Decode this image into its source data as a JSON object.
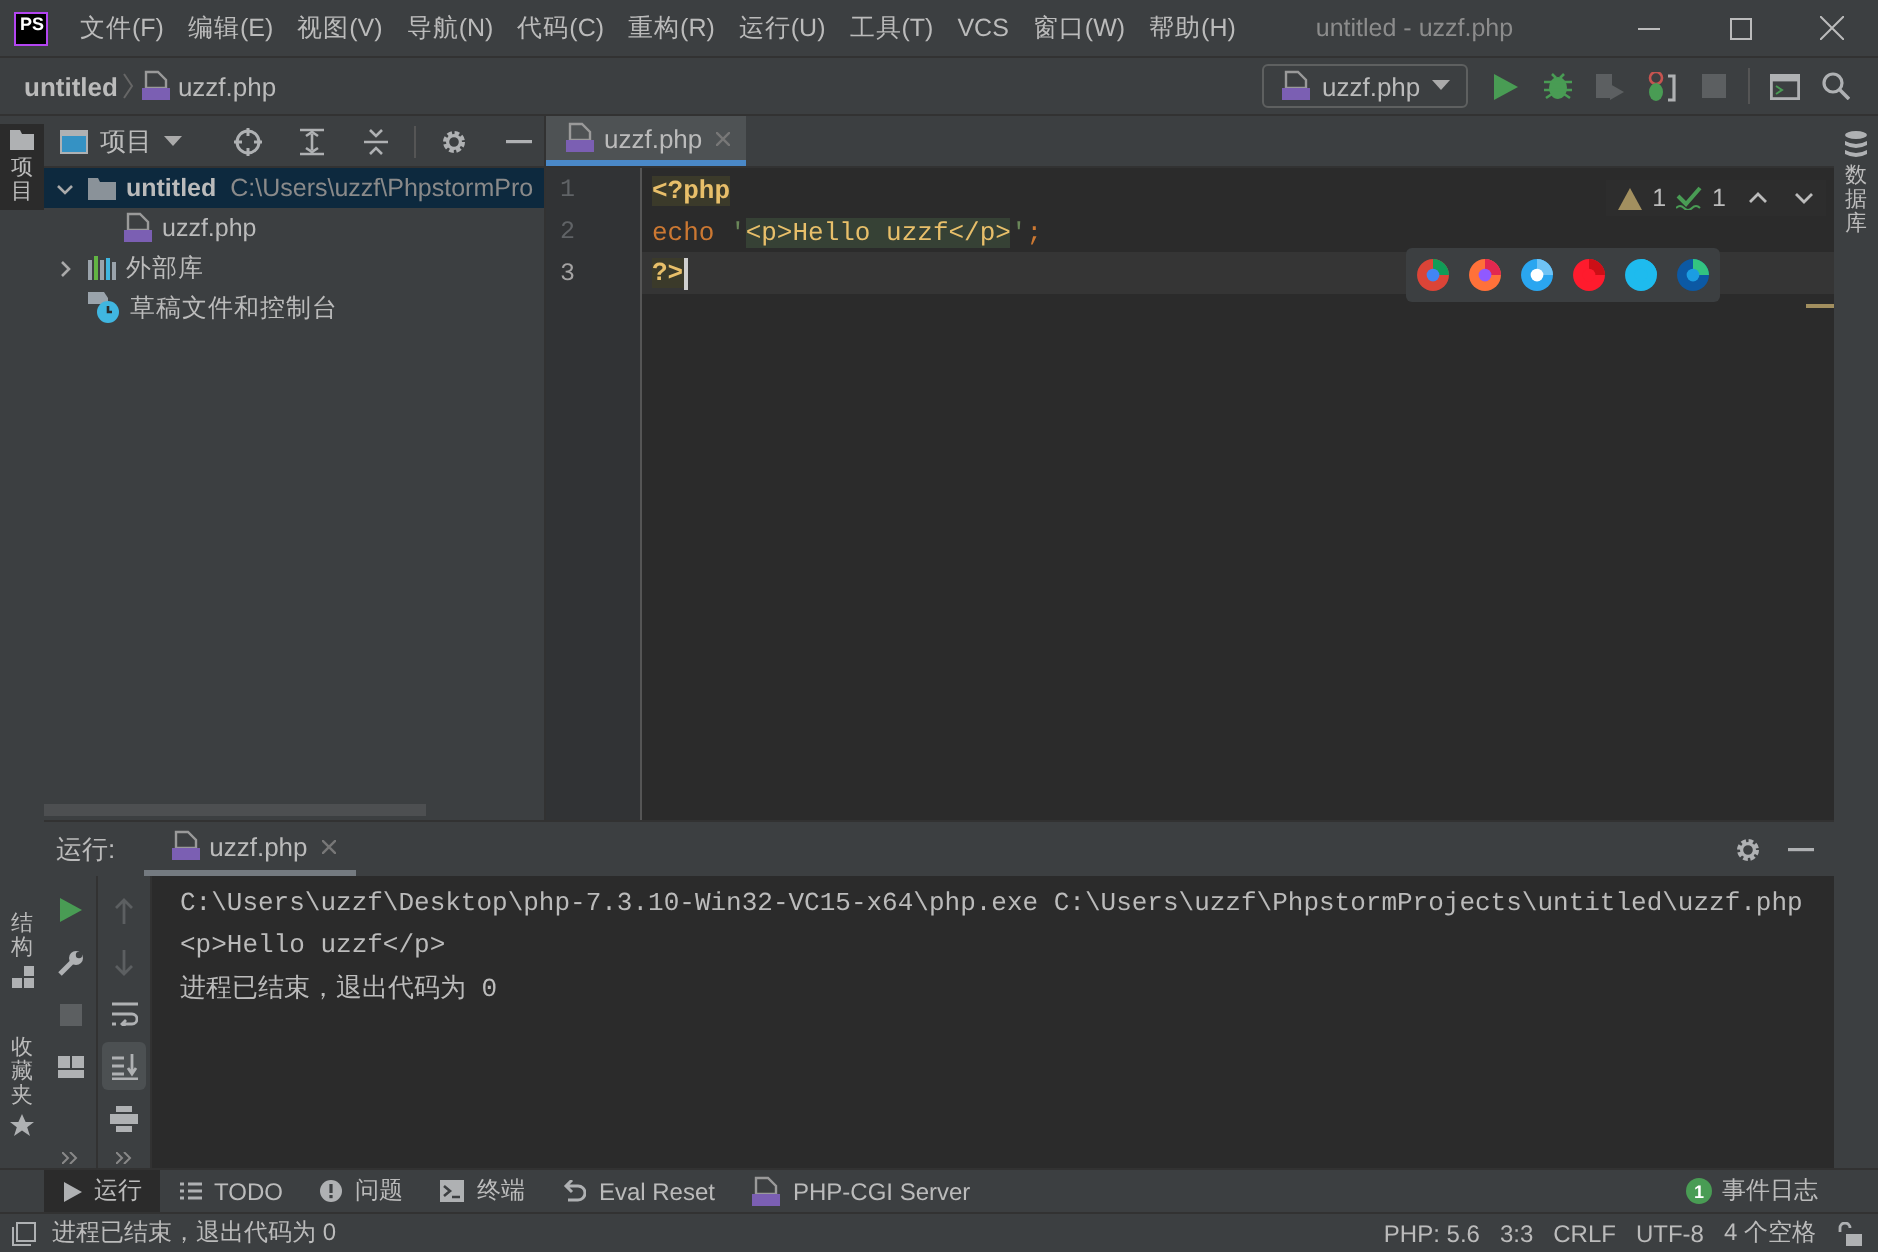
{
  "title_bar": {
    "logo": "PS",
    "menus": [
      "文件(F)",
      "编辑(E)",
      "视图(V)",
      "导航(N)",
      "代码(C)",
      "重构(R)",
      "运行(U)",
      "工具(T)",
      "VCS",
      "窗口(W)",
      "帮助(H)"
    ],
    "title": "untitled - uzzf.php"
  },
  "nav_bar": {
    "breadcrumbs": [
      "untitled",
      "uzzf.php"
    ],
    "run_config": "uzzf.php"
  },
  "left_stripe": [
    {
      "label": "项目",
      "selected": true,
      "kind": "project"
    },
    {
      "label": "结构",
      "selected": false,
      "kind": "structure"
    },
    {
      "label": "收藏夹",
      "selected": false,
      "kind": "favorites"
    }
  ],
  "project": {
    "title": "项目",
    "tree": [
      {
        "label": "untitled",
        "path": "C:\\Users\\uzzf\\PhpstormPro",
        "kind": "folder",
        "expanded": true,
        "selected": true,
        "children": [
          {
            "label": "uzzf.php",
            "kind": "php",
            "selected": false
          }
        ]
      },
      {
        "label": "外部库",
        "kind": "library",
        "expanded": false,
        "selected": false
      },
      {
        "label": "草稿文件和控制台",
        "kind": "scratch",
        "selected": false
      }
    ]
  },
  "editor": {
    "tabs": [
      {
        "label": "uzzf.php",
        "selected": true
      }
    ],
    "lines": [
      {
        "number": "1",
        "current": false,
        "tokens": [
          {
            "text": "<?php",
            "kind": "php_tag"
          }
        ]
      },
      {
        "number": "2",
        "current": false,
        "tokens": [
          {
            "text": "echo ",
            "kind": "keyword"
          },
          {
            "text": "'",
            "kind": "string"
          },
          {
            "text": "<p>Hello uzzf</p>",
            "kind": "injected"
          },
          {
            "text": "'",
            "kind": "string"
          },
          {
            "text": ";",
            "kind": "keyword"
          }
        ]
      },
      {
        "number": "3",
        "current": true,
        "tokens": [
          {
            "text": "?>",
            "kind": "php_tag"
          }
        ]
      }
    ],
    "inspections": {
      "warnings": "1",
      "weak_warnings": "1"
    }
  },
  "right_stripe": [
    {
      "label": "数据库",
      "kind": "database"
    }
  ],
  "run_panel": {
    "label": "运行:",
    "tabs": [
      {
        "label": "uzzf.php",
        "selected": true
      }
    ],
    "scroll_to_end": true,
    "console": [
      "C:\\Users\\uzzf\\Desktop\\php-7.3.10-Win32-VC15-x64\\php.exe C:\\Users\\uzzf\\PhpstormProjects\\untitled\\uzzf.php",
      "<p>Hello uzzf</p>",
      "进程已结束，退出代码为 0"
    ]
  },
  "tool_buttons": [
    {
      "label": "运行",
      "kind": "run",
      "selected": true
    },
    {
      "label": "TODO",
      "kind": "todo",
      "selected": false
    },
    {
      "label": "问题",
      "kind": "problems",
      "selected": false
    },
    {
      "label": "终端",
      "kind": "terminal",
      "selected": false
    },
    {
      "label": "Eval Reset",
      "kind": "reset",
      "selected": false
    },
    {
      "label": "PHP-CGI Server",
      "kind": "php",
      "selected": false
    }
  ],
  "event_log": {
    "count": "1",
    "label": "事件日志"
  },
  "status_bar": {
    "message": "进程已结束，退出代码为 0",
    "items": [
      "PHP: 5.6",
      "3:3",
      "CRLF",
      "UTF-8",
      "4 个空格"
    ]
  }
}
